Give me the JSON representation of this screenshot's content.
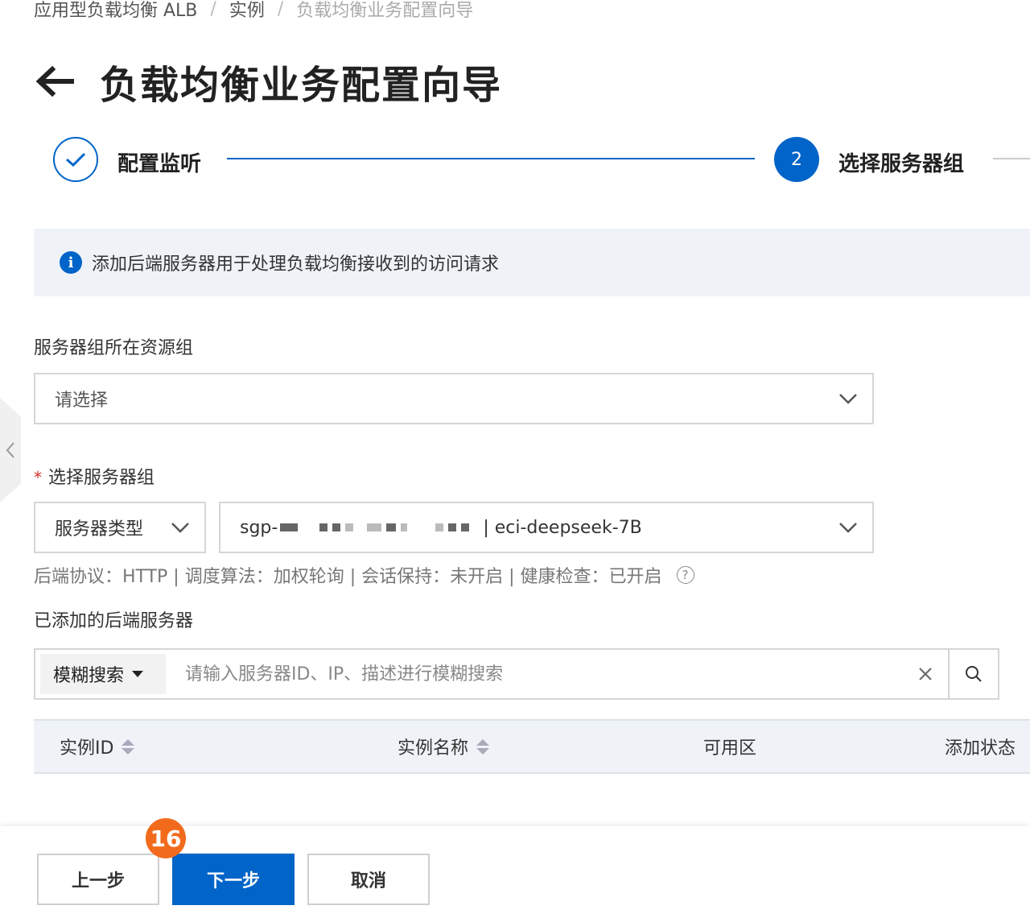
{
  "breadcrumb": {
    "item1": "应用型负载均衡 ALB",
    "sep": "/",
    "item2": "实例",
    "item3": "负载均衡业务配置向导"
  },
  "header": {
    "title": "负载均衡业务配置向导"
  },
  "steps": {
    "step1_label": "配置监听",
    "step2_number": "2",
    "step2_label": "选择服务器组"
  },
  "info": {
    "text": "添加后端服务器用于处理负载均衡接收到的访问请求"
  },
  "resource_group": {
    "label": "服务器组所在资源组",
    "placeholder": "请选择"
  },
  "server_group": {
    "required_mark": "*",
    "label": "选择服务器组",
    "type_value": "服务器类型",
    "group_prefix": "sgp-",
    "group_suffix": "| eci-deepseek-7B",
    "details": "后端协议：HTTP | 调度算法：加权轮询 | 会话保持：未开启 | 健康检查：已开启",
    "help_symbol": "?"
  },
  "added_servers": {
    "label": "已添加的后端服务器",
    "search_type": "模糊搜索",
    "search_placeholder": "请输入服务器ID、IP、描述进行模糊搜索",
    "search_value": ""
  },
  "table": {
    "columns": [
      "实例ID",
      "实例名称",
      "可用区",
      "添加状态"
    ]
  },
  "footer": {
    "prev_label": "上一步",
    "next_label": "下一步",
    "cancel_label": "取消",
    "badge": "16"
  },
  "colors": {
    "primary": "#0064c8",
    "badge": "#f26b1d",
    "required": "#d93026",
    "info_bg": "#eff3f8"
  }
}
